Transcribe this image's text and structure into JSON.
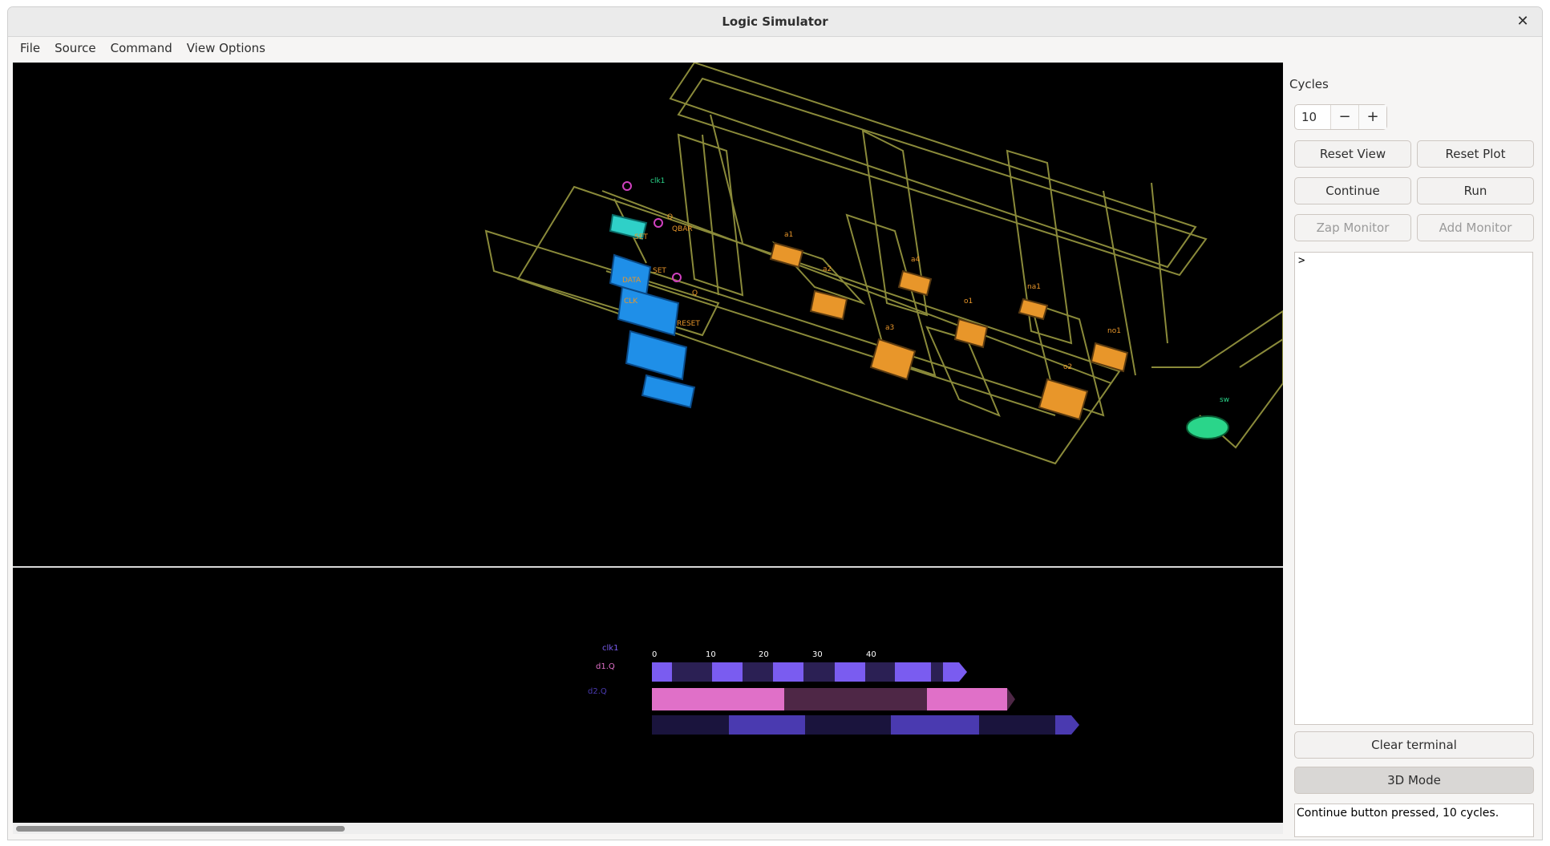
{
  "window": {
    "title": "Logic Simulator"
  },
  "menu": [
    "File",
    "Source",
    "Command",
    "View Options"
  ],
  "scene": {
    "labels": {
      "clk1": "clk1",
      "a1": "a1",
      "a2": "a2",
      "a3": "a3",
      "a4": "a4",
      "na1": "na1",
      "o1": "o1",
      "o2": "o2",
      "no1": "no1",
      "sw": "sw",
      "q1": "Q",
      "q2": "Q",
      "qbar": "QBAR",
      "data": "DATA",
      "set1": "SET",
      "set2": "SET",
      "reset": "RESET",
      "clk": "CLK"
    },
    "colors": {
      "wire": "#8a8a3a",
      "gate": "#e8962a",
      "dtype": "#1f8fe8",
      "clock": "#2fd0c8",
      "switch": "#2ad58a",
      "pin": "#d040c0"
    }
  },
  "plot": {
    "signals": [
      "clk1",
      "d1.Q",
      "d2.Q"
    ],
    "ticks": [
      "0",
      "10",
      "20",
      "30",
      "40"
    ],
    "colors": {
      "clk1": "#7a5cf0",
      "d1.Q": "#e070c8",
      "d2.Q": "#4a3ab0"
    }
  },
  "sidebar": {
    "cycles_label": "Cycles",
    "cycles_value": "10",
    "minus": "−",
    "plus": "+",
    "reset_view": "Reset View",
    "reset_plot": "Reset Plot",
    "continue": "Continue",
    "run": "Run",
    "zap_monitor": "Zap Monitor",
    "add_monitor": "Add Monitor",
    "terminal_text": ">",
    "clear_terminal": "Clear terminal",
    "mode_3d": "3D Mode",
    "status": "Continue button pressed, 10 cycles."
  }
}
